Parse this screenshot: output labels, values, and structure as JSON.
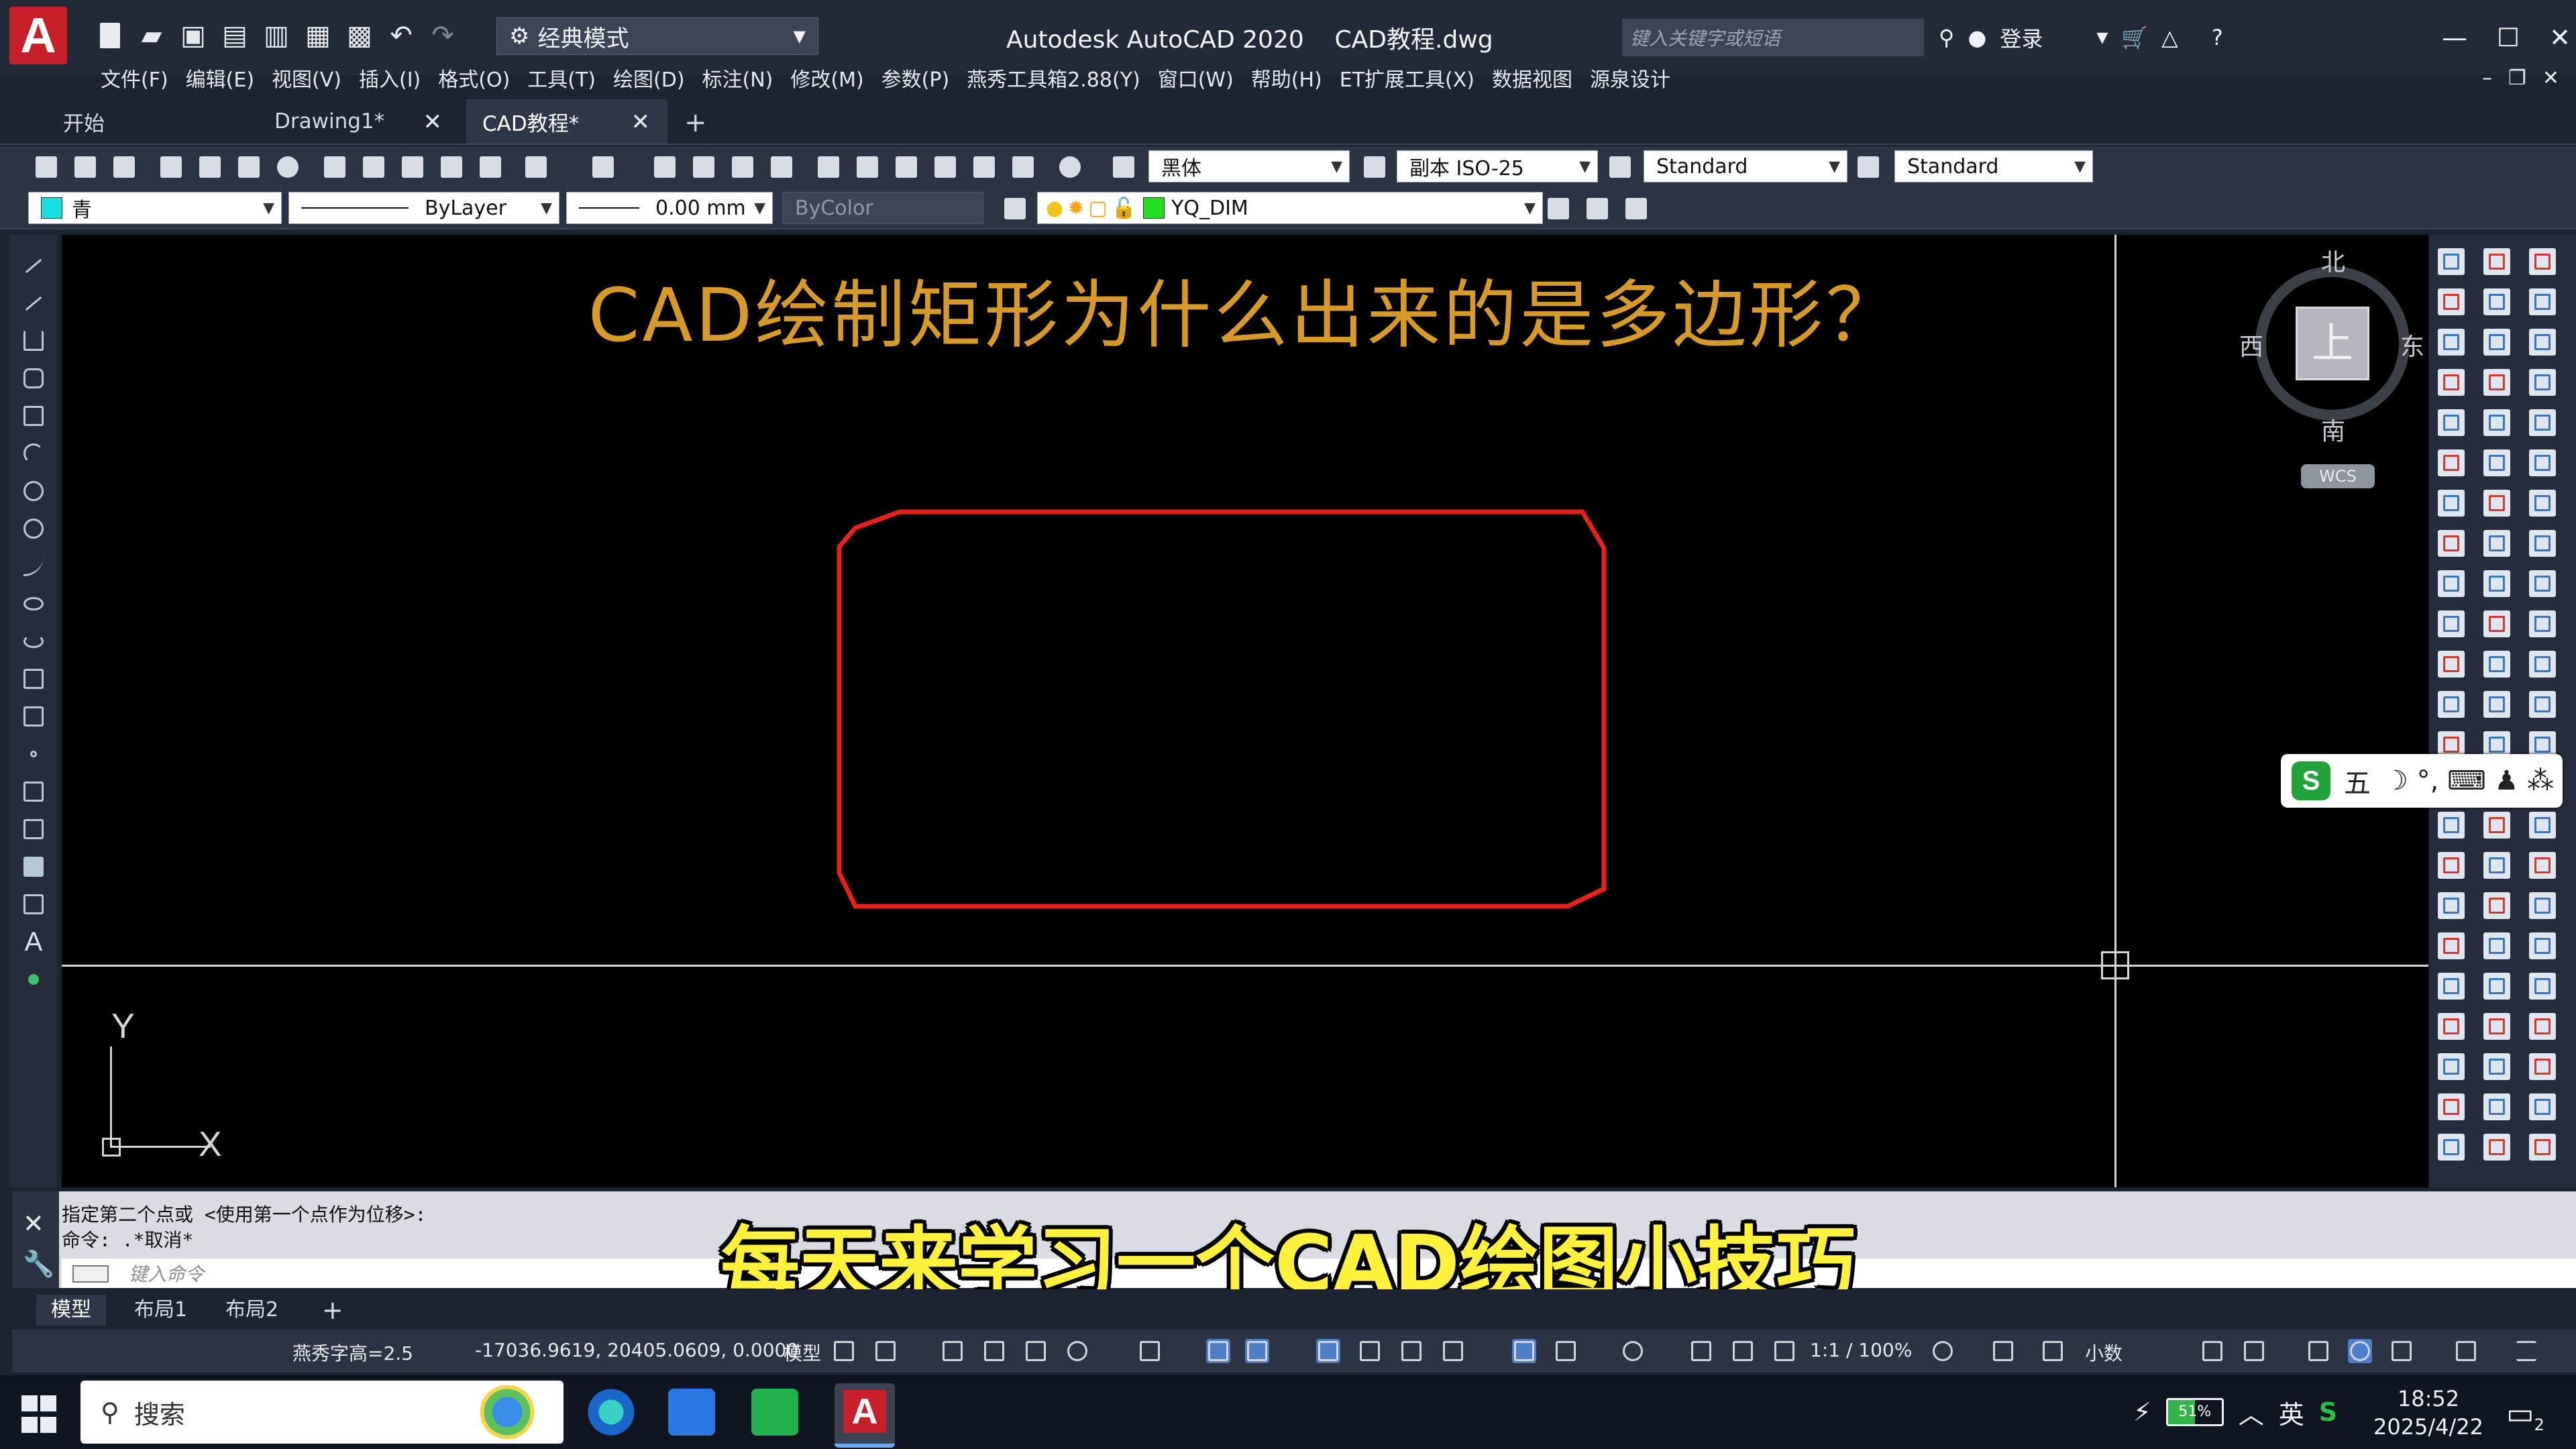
{
  "app": {
    "title": "Autodesk AutoCAD 2020    CAD教程.dwg",
    "workspace": "经典模式",
    "search_placeholder": "键入关键字或短语",
    "login": "登录"
  },
  "menubar": [
    "文件(F)",
    "编辑(E)",
    "视图(V)",
    "插入(I)",
    "格式(O)",
    "工具(T)",
    "绘图(D)",
    "标注(N)",
    "修改(M)",
    "参数(P)",
    "燕秀工具箱2.88(Y)",
    "窗口(W)",
    "帮助(H)",
    "ET扩展工具(X)",
    "数据视图",
    "源泉设计"
  ],
  "tabs": [
    {
      "label": "开始"
    },
    {
      "label": "Drawing1*"
    },
    {
      "label": "CAD教程*"
    }
  ],
  "toolbar": {
    "text_style": "黑体",
    "dim_style": "副本 ISO-25",
    "table_style": "Standard",
    "multileader_style": "Standard",
    "color": "青",
    "color_hex": "#19e0e0",
    "linetype": "ByLayer",
    "lineweight": "0.00 mm",
    "plotstyle": "ByColor",
    "layer": "YQ_DIM",
    "layer_color_hex": "#22dd22"
  },
  "canvas": {
    "headline": "CAD绘制矩形为什么出来的是多边形？",
    "shape_color": "#e8201c",
    "viewcube": {
      "north": "北",
      "south": "南",
      "east": "东",
      "west": "西",
      "face": "上",
      "wcs": "WCS"
    },
    "ucs": {
      "x": "X",
      "y": "Y"
    }
  },
  "ime": {
    "logo": "S",
    "mode": "五",
    "icons": "☽ °, ⌨ ♟ ⁂"
  },
  "command": {
    "history": [
      "指定第二个点或 <使用第一个点作为位移>:",
      "命令: .*取消*"
    ],
    "placeholder": "键入命令"
  },
  "subtitle": "每天来学习一个CAD绘图小技巧",
  "layout_tabs": [
    "模型",
    "布局1",
    "布局2"
  ],
  "status": {
    "text_height": "燕秀字高=2.5",
    "coordinates": "-17036.9619, 20405.0609, 0.0000",
    "space": "模型",
    "scale": "1:1 / 100%",
    "units": "小数"
  },
  "taskbar": {
    "search": "搜索",
    "battery": "51%",
    "ime_lang": "英",
    "time": "18:52",
    "date": "2025/4/22",
    "notifications": "2"
  }
}
